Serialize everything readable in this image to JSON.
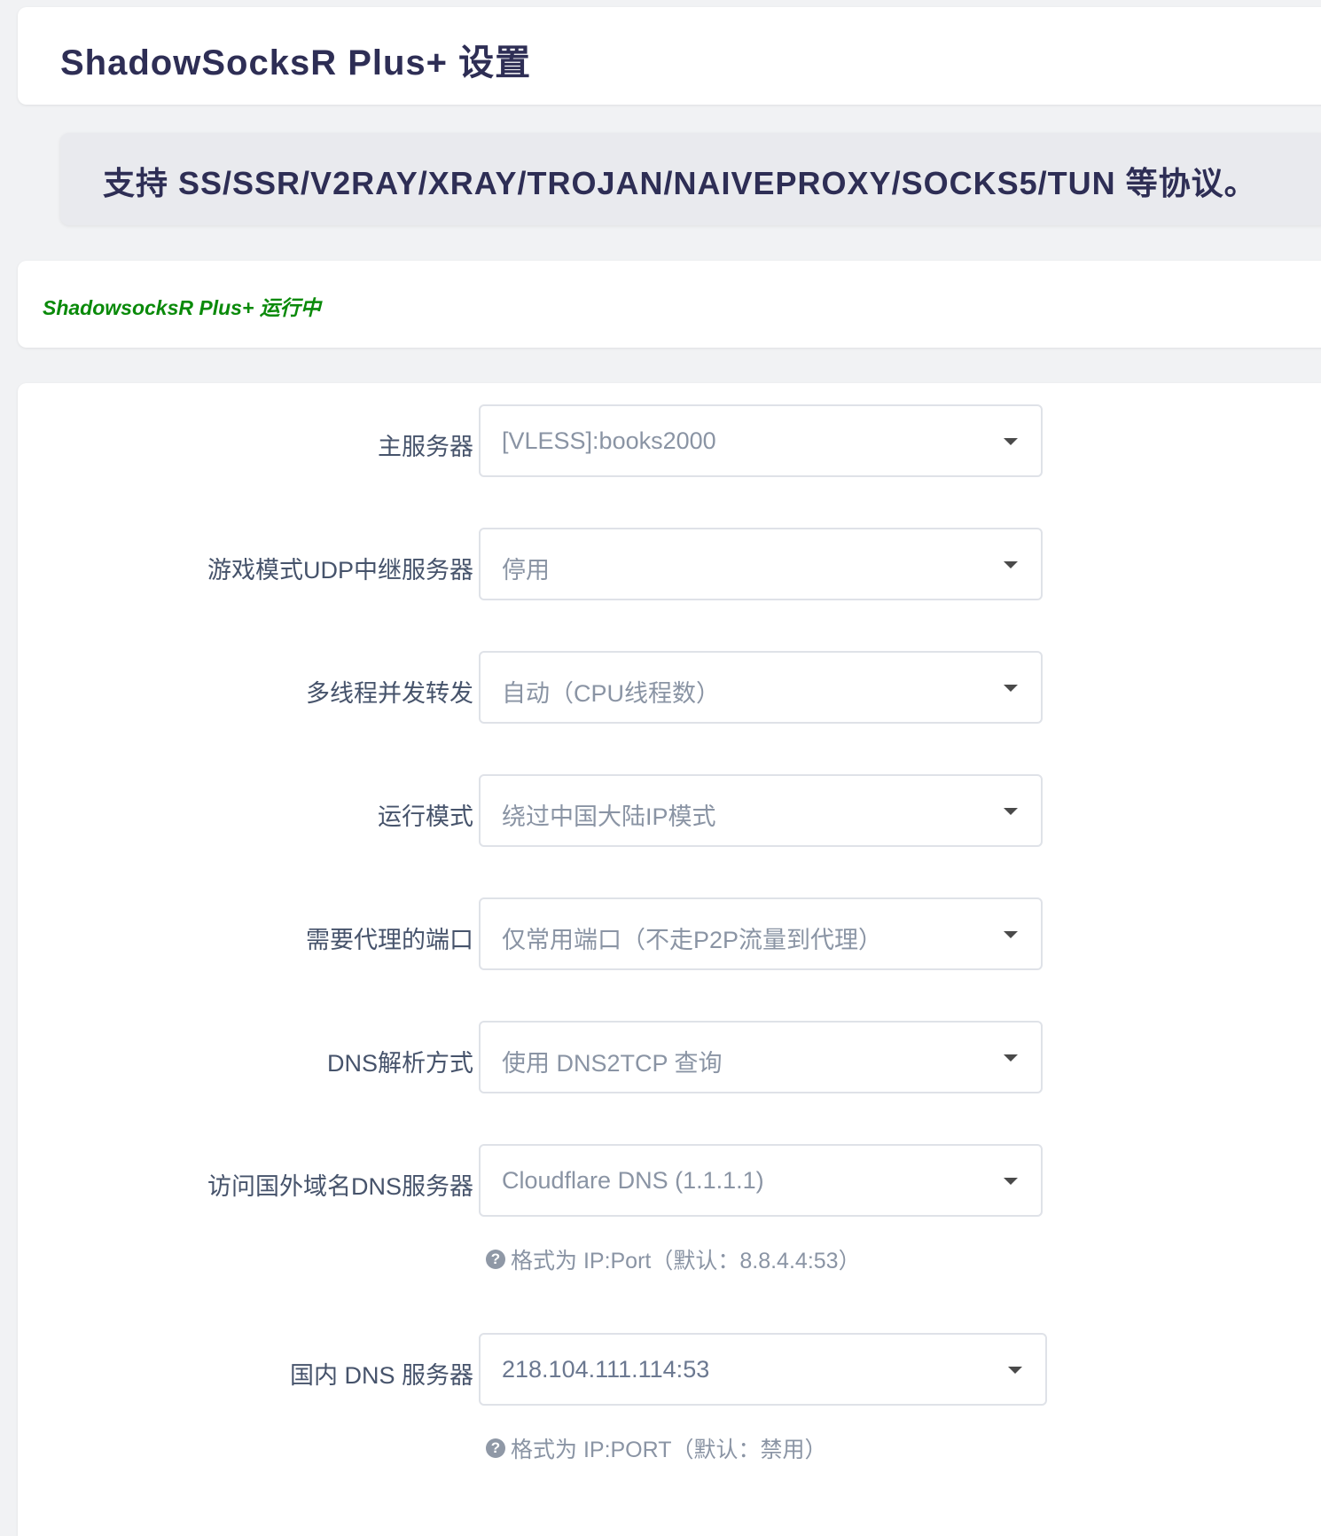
{
  "header": {
    "title": "ShadowSocksR Plus+ 设置"
  },
  "banner": {
    "text": "支持 SS/SSR/V2RAY/XRAY/TROJAN/NAIVEPROXY/SOCKS5/TUN 等协议。"
  },
  "status": {
    "text": "ShadowsocksR Plus+ 运行中",
    "color": "#0a8a0a"
  },
  "form": {
    "fields": [
      {
        "label": "主服务器",
        "value": "[VLESS]:books2000"
      },
      {
        "label": "游戏模式UDP中继服务器",
        "value": "停用"
      },
      {
        "label": "多线程并发转发",
        "value": "自动（CPU线程数）"
      },
      {
        "label": "运行模式",
        "value": "绕过中国大陆IP模式"
      },
      {
        "label": "需要代理的端口",
        "value": "仅常用端口（不走P2P流量到代理）"
      },
      {
        "label": "DNS解析方式",
        "value": "使用 DNS2TCP 查询"
      },
      {
        "label": "访问国外域名DNS服务器",
        "value": "Cloudflare DNS (1.1.1.1)",
        "hint": "格式为 IP:Port（默认：8.8.4.4:53）"
      },
      {
        "label": "国内 DNS 服务器",
        "value": "218.104.111.114:53",
        "hint": "格式为 IP:PORT（默认：禁用）"
      }
    ]
  },
  "icons": {
    "help": "question-circle-icon",
    "caret": "caret-down-icon"
  }
}
